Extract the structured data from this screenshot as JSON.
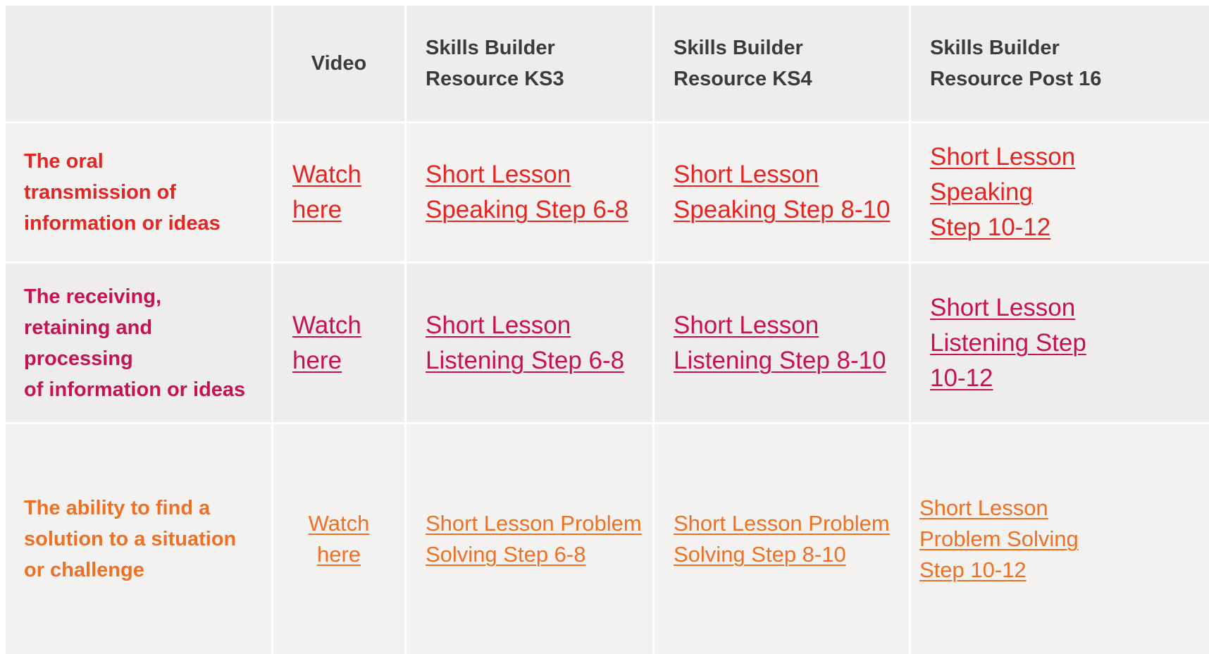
{
  "colors": {
    "row1": "#e52521",
    "row2": "#c8124f",
    "row3": "#ef7023",
    "header_text": "#3b3b3b",
    "cell_bg": "#f4f2f0"
  },
  "header": {
    "video": "Video",
    "ks3": "Skills Builder\nResource KS3",
    "ks4": "Skills Builder\nResource KS4",
    "post16": "Skills Builder\nResource Post 16"
  },
  "rows": [
    {
      "label": "The oral\ntransmission of\ninformation or ideas",
      "video": "Watch\nhere",
      "ks3": "Short Lesson\nSpeaking Step 6-8",
      "ks4": "Short Lesson\nSpeaking Step 8-10",
      "post16": "Short Lesson\nSpeaking\nStep 10-12"
    },
    {
      "label": "The receiving,\nretaining and\nprocessing\nof information or ideas",
      "video": "Watch\nhere",
      "ks3": "Short Lesson\nListening Step 6-8",
      "ks4": "Short Lesson\nListening  Step 8-10",
      "post16": "Short Lesson\nListening Step\n10-12"
    },
    {
      "label": "The ability to find a\nsolution to a situation\nor challenge",
      "video": "Watch\nhere",
      "ks3": "Short Lesson Problem\nSolving Step 6-8",
      "ks4": "Short Lesson Problem\nSolving Step 8-10",
      "post16": "Short Lesson\nProblem Solving\nStep 10-12"
    }
  ]
}
